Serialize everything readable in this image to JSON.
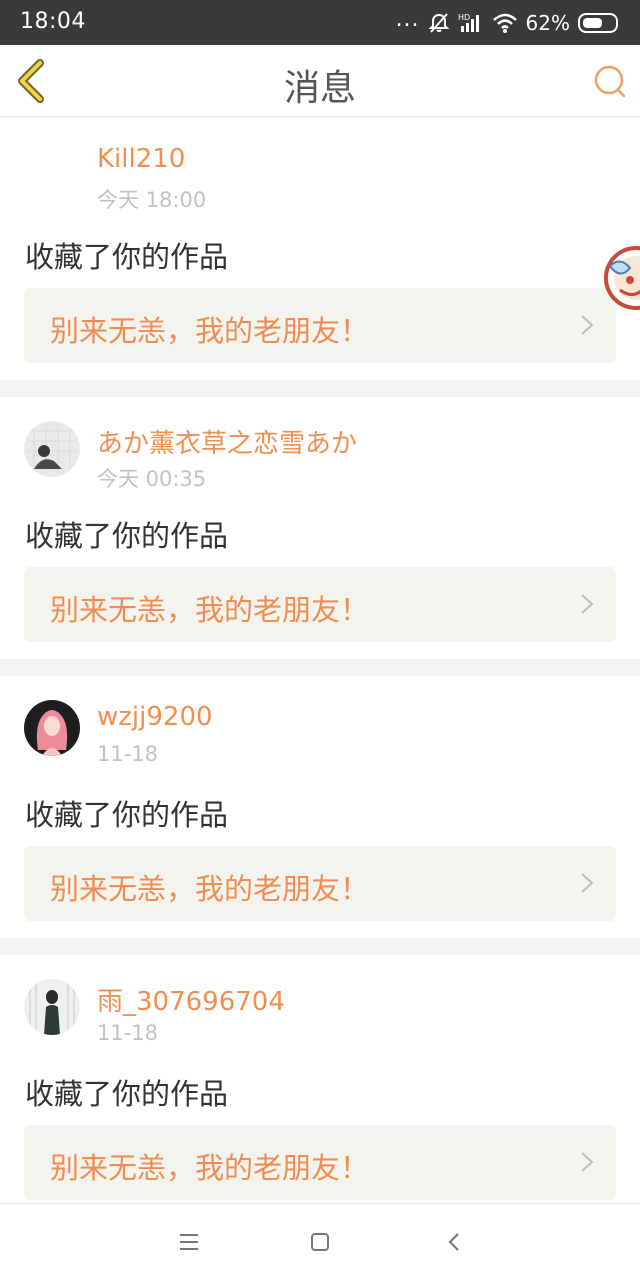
{
  "status_bar": {
    "time": "18:04",
    "dots": "...",
    "battery": "62%",
    "battery_level": 0.62,
    "icons": [
      "mute-icon",
      "hd-signal-icon",
      "wifi-icon",
      "battery-icon"
    ]
  },
  "header": {
    "title": "消息",
    "back_icon": "chevron-left-icon",
    "search_icon": "search-icon",
    "accent_color": "#f0a060"
  },
  "messages": [
    {
      "username": "Kill210",
      "time": "今天 18:00",
      "action": "收藏了你的作品",
      "work_title": "别来无恙，我的老朋友！",
      "has_avatar": false
    },
    {
      "username": "あか薰衣草之恋雪あか",
      "time": "今天 00:35",
      "action": "收藏了你的作品",
      "work_title": "别来无恙，我的老朋友！",
      "has_avatar": true
    },
    {
      "username": "wzjj9200",
      "time": "11-18",
      "action": "收藏了你的作品",
      "work_title": "别来无恙，我的老朋友！",
      "has_avatar": true
    },
    {
      "username": "雨_307696704",
      "time": "11-18",
      "action": "收藏了你的作品",
      "work_title": "别来无恙，我的老朋友！",
      "has_avatar": true
    }
  ],
  "colors": {
    "username": "#f09050",
    "work_title": "#ef8d55",
    "work_bg": "#f4f4ee",
    "timestamp": "#c2c2c2"
  },
  "nav": {
    "icons": [
      "menu-icon",
      "home-square-icon",
      "back-triangle-icon"
    ]
  }
}
